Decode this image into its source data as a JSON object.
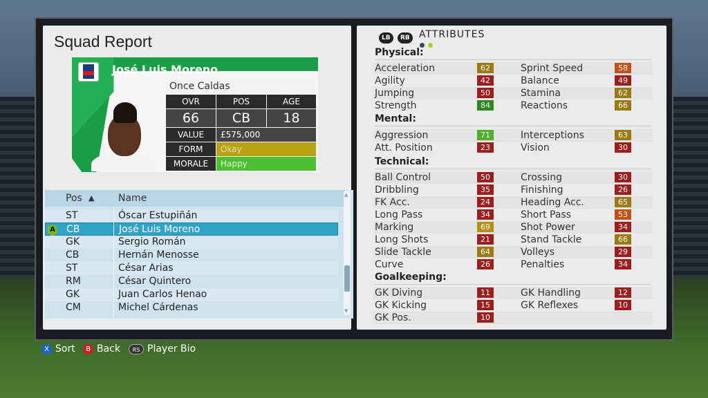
{
  "title": "Squad Report",
  "player": {
    "name": "José Luis Moreno",
    "club": "Once Caldas",
    "headers": {
      "ovr": "OVR",
      "pos": "POS",
      "age": "AGE"
    },
    "ovr": "66",
    "pos": "CB",
    "age": "18",
    "value_label": "VALUE",
    "value": "£575,000",
    "form_label": "FORM",
    "form": "Okay",
    "morale_label": "MORALE",
    "morale": "Happy"
  },
  "list": {
    "col_pos": "Pos",
    "sort_arrow": "▲",
    "col_name": "Name",
    "a_button": "A",
    "rows": [
      {
        "pos": "ST",
        "name": "Óscar Estupiñán"
      },
      {
        "pos": "CB",
        "name": "José Luis Moreno"
      },
      {
        "pos": "GK",
        "name": "Sergio Román"
      },
      {
        "pos": "CB",
        "name": "Hernán Menosse"
      },
      {
        "pos": "ST",
        "name": "César Arias"
      },
      {
        "pos": "RM",
        "name": "César Quintero"
      },
      {
        "pos": "GK",
        "name": "Juan Carlos Henao"
      },
      {
        "pos": "CM",
        "name": "Michel Cárdenas"
      }
    ],
    "selected_index": 1
  },
  "controls": {
    "sort": {
      "btn": "X",
      "label": "Sort",
      "color": "#1a64c8"
    },
    "back": {
      "btn": "B",
      "label": "Back",
      "color": "#c8202a"
    },
    "bio": {
      "btn": "RS",
      "label": "Player Bio",
      "color": "#333333"
    }
  },
  "attributes": {
    "lb": "LB",
    "rb": "RB",
    "title": "ATTRIBUTES",
    "physical": "Physical:",
    "mental": "Mental:",
    "technical": "Technical:",
    "goalkeeping": "Goalkeeping:",
    "items": [
      {
        "label": "Acceleration",
        "value": "62",
        "color": "#9a7a12"
      },
      {
        "label": "Sprint Speed",
        "value": "58",
        "color": "#c2521a"
      },
      {
        "label": "Agility",
        "value": "42",
        "color": "#9c1f1f"
      },
      {
        "label": "Balance",
        "value": "49",
        "color": "#9c1f1f"
      },
      {
        "label": "Jumping",
        "value": "50",
        "color": "#9c1f1f"
      },
      {
        "label": "Stamina",
        "value": "62",
        "color": "#9a7a12"
      },
      {
        "label": "Strength",
        "value": "84",
        "color": "#2b8a1f"
      },
      {
        "label": "Reactions",
        "value": "66",
        "color": "#9a7a12"
      },
      {
        "label": "Aggression",
        "value": "71",
        "color": "#4fb12a"
      },
      {
        "label": "Interceptions",
        "value": "63",
        "color": "#9a7a12"
      },
      {
        "label": "Att. Position",
        "value": "23",
        "color": "#9c1f1f"
      },
      {
        "label": "Vision",
        "value": "30",
        "color": "#9c1f1f"
      },
      {
        "label": "Ball Control",
        "value": "50",
        "color": "#9c1f1f"
      },
      {
        "label": "Crossing",
        "value": "30",
        "color": "#9c1f1f"
      },
      {
        "label": "Dribbling",
        "value": "35",
        "color": "#9c1f1f"
      },
      {
        "label": "Finishing",
        "value": "26",
        "color": "#9c1f1f"
      },
      {
        "label": "FK Acc.",
        "value": "24",
        "color": "#9c1f1f"
      },
      {
        "label": "Heading Acc.",
        "value": "65",
        "color": "#9a7a12"
      },
      {
        "label": "Long Pass",
        "value": "34",
        "color": "#9c1f1f"
      },
      {
        "label": "Short Pass",
        "value": "53",
        "color": "#c2521a"
      },
      {
        "label": "Marking",
        "value": "69",
        "color": "#b48f12"
      },
      {
        "label": "Shot Power",
        "value": "34",
        "color": "#9c1f1f"
      },
      {
        "label": "Long Shots",
        "value": "21",
        "color": "#9c1f1f"
      },
      {
        "label": "Stand Tackle",
        "value": "66",
        "color": "#9a7a12"
      },
      {
        "label": "Slide Tackle",
        "value": "64",
        "color": "#9a7a12"
      },
      {
        "label": "Volleys",
        "value": "29",
        "color": "#9c1f1f"
      },
      {
        "label": "Curve",
        "value": "26",
        "color": "#9c1f1f"
      },
      {
        "label": "Penalties",
        "value": "34",
        "color": "#9c1f1f"
      },
      {
        "label": "GK Diving",
        "value": "11",
        "color": "#9c1f1f"
      },
      {
        "label": "GK Handling",
        "value": "12",
        "color": "#9c1f1f"
      },
      {
        "label": "GK Kicking",
        "value": "15",
        "color": "#9c1f1f"
      },
      {
        "label": "GK Reflexes",
        "value": "10",
        "color": "#9c1f1f"
      },
      {
        "label": "GK Pos.",
        "value": "10",
        "color": "#9c1f1f"
      }
    ]
  },
  "colors": {
    "form": "#b8a214",
    "morale": "#4cbf32",
    "card_green": "#1a9e45"
  }
}
